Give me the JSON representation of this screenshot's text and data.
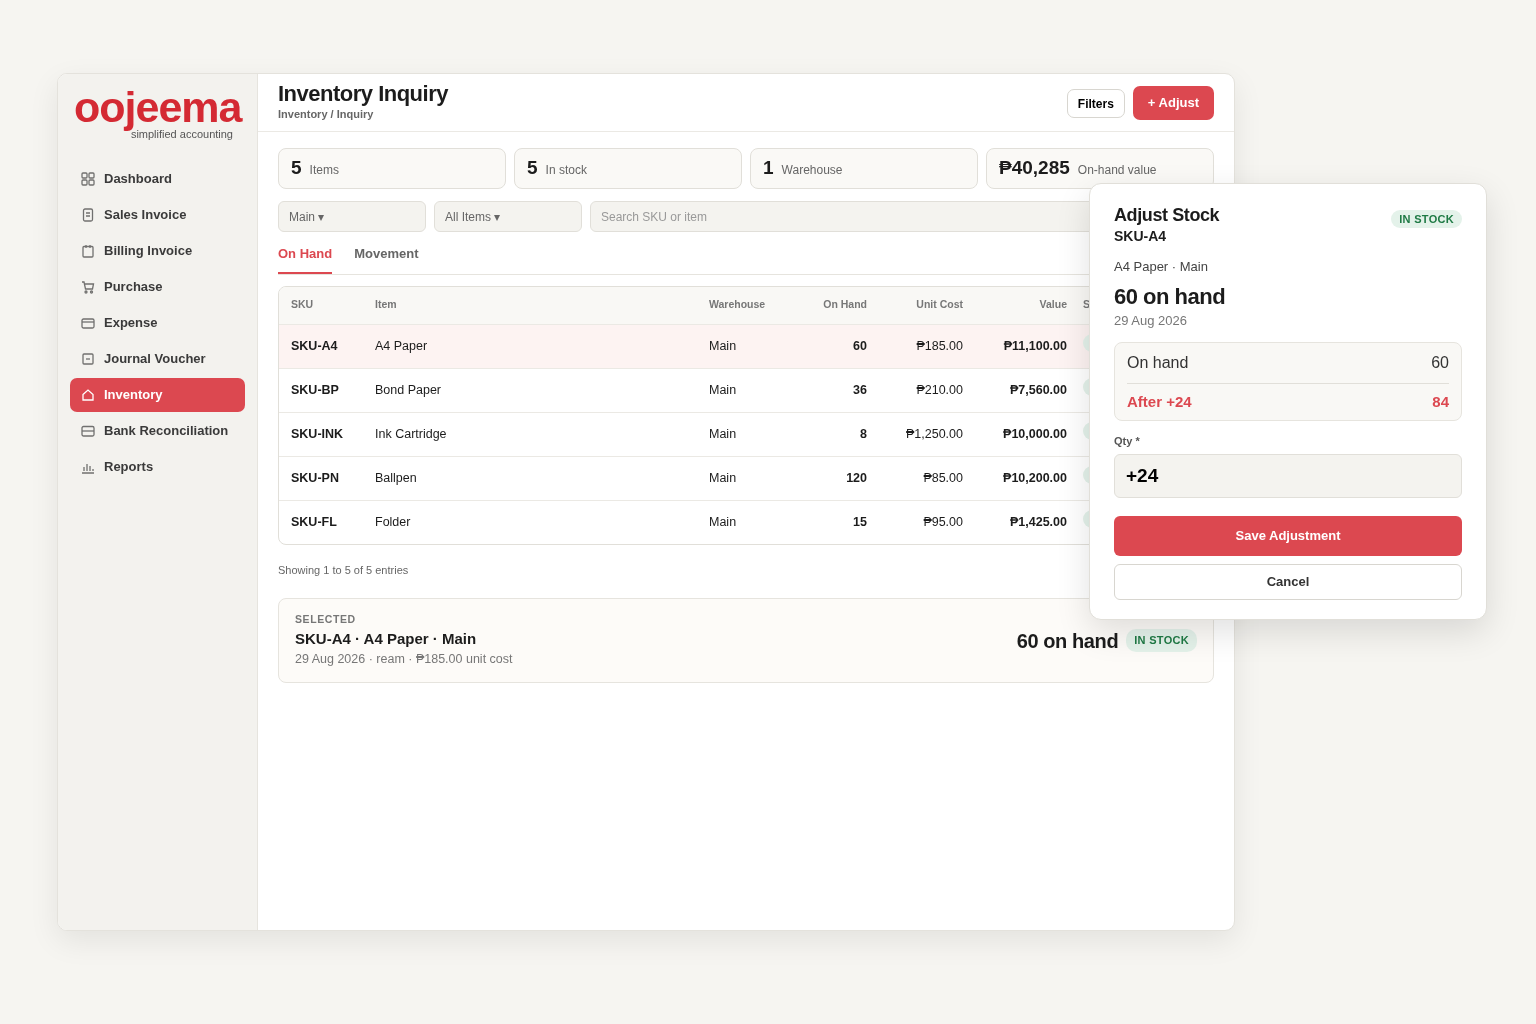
{
  "logo": {
    "name": "oojeema",
    "tagline": "simplified accounting"
  },
  "sidebar": {
    "items": [
      {
        "label": "Dashboard",
        "selected": false
      },
      {
        "label": "Sales Invoice",
        "selected": false
      },
      {
        "label": "Billing Invoice",
        "selected": false
      },
      {
        "label": "Purchase",
        "selected": false
      },
      {
        "label": "Expense",
        "selected": false
      },
      {
        "label": "Journal Voucher",
        "selected": false
      },
      {
        "label": "Inventory",
        "selected": true
      },
      {
        "label": "Bank Reconciliation",
        "selected": false
      },
      {
        "label": "Reports",
        "selected": false
      }
    ]
  },
  "header": {
    "title": "Inventory Inquiry",
    "breadcrumb": "Inventory / Inquiry",
    "buttons": [
      {
        "label": "Filters",
        "kind": "outline"
      },
      {
        "label": "+ Adjust",
        "kind": "primary"
      }
    ]
  },
  "stats": [
    {
      "value": "5",
      "label": "Items"
    },
    {
      "value": "5",
      "label": "In stock"
    },
    {
      "value": "1",
      "label": "Warehouse"
    },
    {
      "value": "₱40,285",
      "label": "On-hand value"
    }
  ],
  "filters": [
    {
      "kind": "select",
      "value": "Main ▾"
    },
    {
      "kind": "select",
      "value": "All Items ▾"
    },
    {
      "kind": "search",
      "placeholder": "Search SKU or item"
    }
  ],
  "tabs": [
    {
      "label": "On Hand",
      "selected": true
    },
    {
      "label": "Movement",
      "selected": false
    }
  ],
  "table": {
    "columns": [
      "SKU",
      "Item",
      "Warehouse",
      "On Hand",
      "Unit Cost",
      "Value",
      "S"
    ],
    "rows": [
      {
        "sku": "SKU-A4",
        "item": "A4 Paper",
        "warehouse": "Main",
        "on_hand": "60",
        "unit_cost": "₱185.00",
        "value": "₱11,100.00",
        "selected": true
      },
      {
        "sku": "SKU-BP",
        "item": "Bond Paper",
        "warehouse": "Main",
        "on_hand": "36",
        "unit_cost": "₱210.00",
        "value": "₱7,560.00",
        "selected": false
      },
      {
        "sku": "SKU-INK",
        "item": "Ink Cartridge",
        "warehouse": "Main",
        "on_hand": "8",
        "unit_cost": "₱1,250.00",
        "value": "₱10,000.00",
        "selected": false
      },
      {
        "sku": "SKU-PN",
        "item": "Ballpen",
        "warehouse": "Main",
        "on_hand": "120",
        "unit_cost": "₱85.00",
        "value": "₱10,200.00",
        "selected": false
      },
      {
        "sku": "SKU-FL",
        "item": "Folder",
        "warehouse": "Main",
        "on_hand": "15",
        "unit_cost": "₱95.00",
        "value": "₱1,425.00",
        "selected": false
      }
    ]
  },
  "table_footer": "Showing 1 to 5 of 5 entries",
  "selected_panel": {
    "label": "SELECTED",
    "title": "SKU-A4 · A4 Paper · Main",
    "details": "29 Aug 2026 · ream · ₱185.00 unit cost",
    "quantity": "60 on hand",
    "status": "IN STOCK"
  },
  "adjust_panel": {
    "title": "Adjust Stock",
    "sku": "SKU-A4",
    "status": "IN STOCK",
    "subtitle": "A4 Paper · Main",
    "quantity": "60 on hand",
    "date": "29 Aug 2026",
    "summary": [
      {
        "label": "On hand",
        "value": "60",
        "kind": "current"
      },
      {
        "label": "After +24",
        "value": "84",
        "kind": "after"
      }
    ],
    "qty_label": "Qty *",
    "qty_value": "+24",
    "buttons": [
      {
        "label": "Save Adjustment",
        "kind": "primary"
      },
      {
        "label": "Cancel",
        "kind": "outline"
      }
    ]
  }
}
